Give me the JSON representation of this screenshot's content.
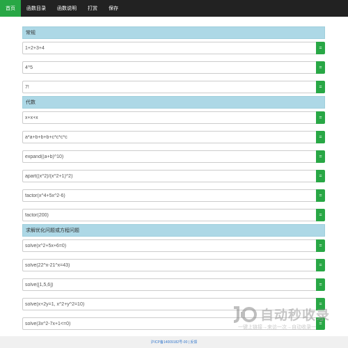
{
  "nav": {
    "items": [
      {
        "label": "首页",
        "active": true
      },
      {
        "label": "函数目录",
        "active": false
      },
      {
        "label": "函数说明",
        "active": false
      },
      {
        "label": "打赏",
        "active": false
      },
      {
        "label": "保存",
        "active": false
      }
    ]
  },
  "sections": [
    {
      "title": "常规",
      "rows": [
        {
          "value": "1+2+3+4",
          "button": "="
        },
        {
          "value": "4^5",
          "button": "="
        },
        {
          "value": "7!",
          "button": "="
        }
      ]
    },
    {
      "title": "代数",
      "rows": [
        {
          "value": "x+x+x",
          "button": "="
        },
        {
          "value": "a*a+b+b+b+c*c*c*c",
          "button": "="
        },
        {
          "value": "expand((a+b)^10)",
          "button": "="
        },
        {
          "value": "apart((x^2)/(x^2+1)^2)",
          "button": "="
        },
        {
          "value": "factor(x^4+5x^2-6)",
          "button": "="
        },
        {
          "value": "factor(200)",
          "button": "="
        }
      ]
    },
    {
      "title": "求解优化问题或方程问题",
      "rows": [
        {
          "value": "solve(x^2+5x+6=0)",
          "button": "="
        },
        {
          "value": "solve(22^x-21^x=43)",
          "button": "="
        },
        {
          "value": "solve([1,5,6])",
          "button": "="
        },
        {
          "value": "solve(x+2y=1, x^2+y^2=10)",
          "button": "="
        },
        {
          "value": "solve(3x^2-7x+1<=0)",
          "button": "="
        }
      ]
    }
  ],
  "footer": {
    "text": "沪ICP备14009182号-00 | 反馈"
  },
  "watermark": {
    "title": "自动秒收录",
    "subtitle": "一键上链接→来访一次→自动收录一"
  },
  "colors": {
    "accent": "#28a745",
    "section_bg": "#add8e6",
    "nav_bg": "#222222"
  }
}
